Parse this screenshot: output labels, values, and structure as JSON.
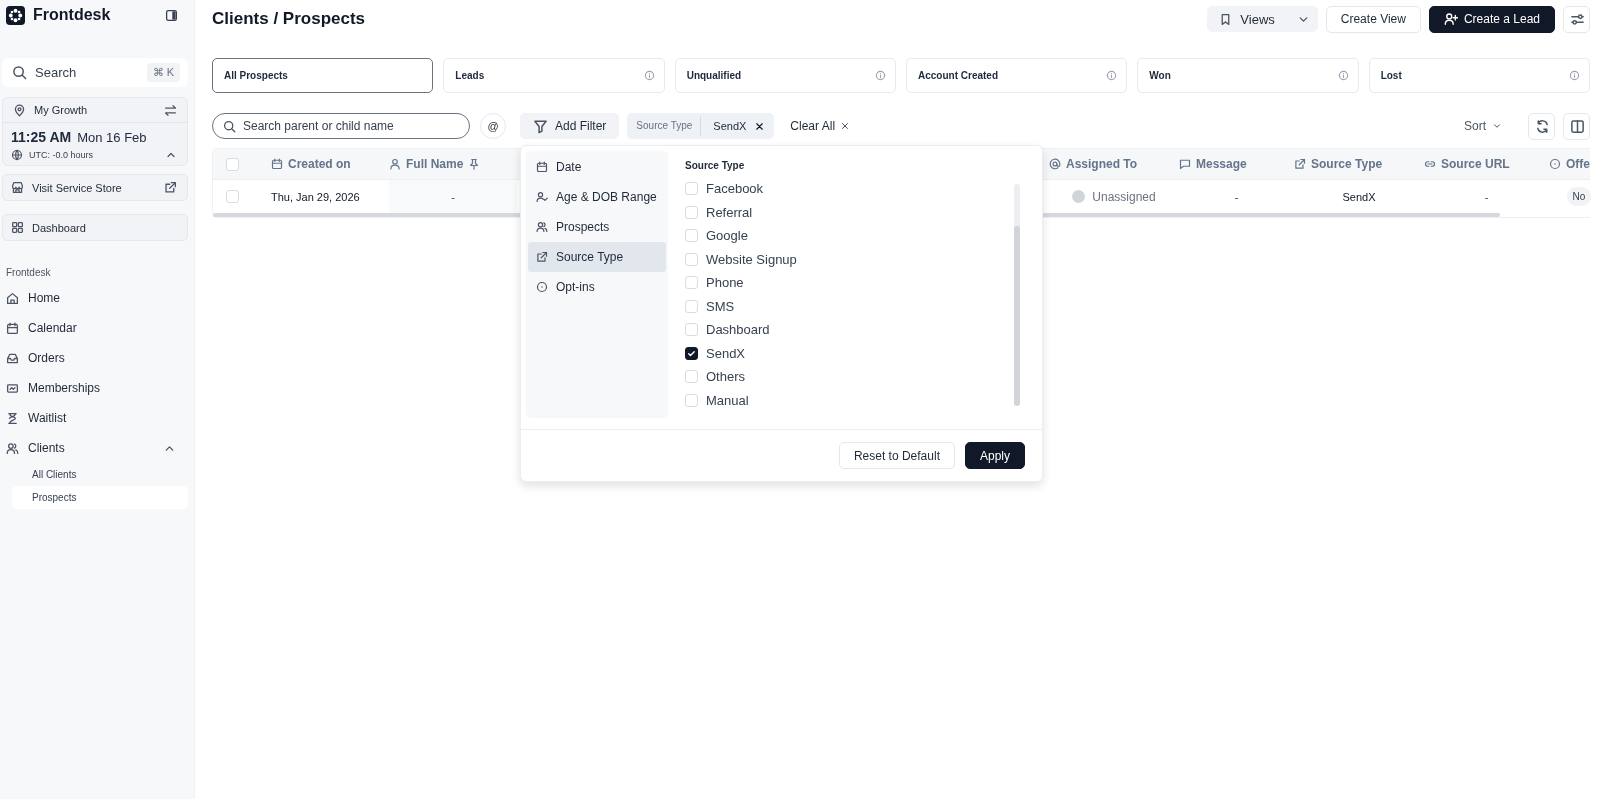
{
  "sidebar": {
    "brand": "Frontdesk",
    "search": {
      "placeholder": "Search",
      "shortcut": "⌘ K"
    },
    "location": {
      "label": "My Growth",
      "time": "11:25 AM",
      "date": "Mon 16 Feb",
      "timezone": "UTC: -0.0 hours",
      "expanded": true
    },
    "links": [
      {
        "label": "Visit Service Store",
        "external": true
      },
      {
        "label": "Dashboard",
        "external": false
      }
    ],
    "section_label": "Frontdesk",
    "nav": [
      {
        "label": "Home"
      },
      {
        "label": "Calendar"
      },
      {
        "label": "Orders"
      },
      {
        "label": "Memberships"
      },
      {
        "label": "Waitlist"
      },
      {
        "label": "Clients",
        "expanded": true,
        "children": [
          {
            "label": "All Clients",
            "selected": false
          },
          {
            "label": "Prospects",
            "selected": true
          }
        ]
      }
    ]
  },
  "header": {
    "title": "Clients / Prospects",
    "views": "Views",
    "create_view": "Create View",
    "create_lead": "Create a Lead"
  },
  "status_tabs": [
    {
      "label": "All Prospects",
      "selected": true,
      "info": false
    },
    {
      "label": "Leads",
      "selected": false,
      "info": true
    },
    {
      "label": "Unqualified",
      "selected": false,
      "info": true
    },
    {
      "label": "Account Created",
      "selected": false,
      "info": true
    },
    {
      "label": "Won",
      "selected": false,
      "info": true
    },
    {
      "label": "Lost",
      "selected": false,
      "info": true
    }
  ],
  "toolbar": {
    "search_placeholder": "Search parent or child name",
    "mention": "@",
    "add_filter": "Add Filter",
    "active_filter": {
      "field": "Source Type",
      "value": "SendX"
    },
    "clear_all": "Clear All",
    "sort": "Sort"
  },
  "table": {
    "select_all_checked": false,
    "columns": [
      {
        "label": "Created on"
      },
      {
        "label": "Full Name"
      },
      {
        "label": "Assigned To"
      },
      {
        "label": "Message"
      },
      {
        "label": "Source Type"
      },
      {
        "label": "Source URL"
      },
      {
        "label": "Offe"
      }
    ],
    "rows": [
      {
        "checked": false,
        "cells": [
          "Thu, Jan 29, 2026",
          "-",
          "Unassigned",
          "-",
          "SendX",
          "-",
          "No"
        ]
      }
    ]
  },
  "filter_popup": {
    "categories": [
      {
        "label": "Date",
        "selected": false
      },
      {
        "label": "Age & DOB Range",
        "selected": false
      },
      {
        "label": "Prospects",
        "selected": false
      },
      {
        "label": "Source Type",
        "selected": true
      },
      {
        "label": "Opt-ins",
        "selected": false
      }
    ],
    "heading": "Source Type",
    "options": [
      {
        "label": "Facebook",
        "checked": false
      },
      {
        "label": "Referral",
        "checked": false
      },
      {
        "label": "Google",
        "checked": false
      },
      {
        "label": "Website Signup",
        "checked": false
      },
      {
        "label": "Phone",
        "checked": false
      },
      {
        "label": "SMS",
        "checked": false
      },
      {
        "label": "Dashboard",
        "checked": false
      },
      {
        "label": "SendX",
        "checked": true
      },
      {
        "label": "Others",
        "checked": false
      },
      {
        "label": "Manual",
        "checked": false
      }
    ],
    "reset": "Reset to Default",
    "apply": "Apply"
  }
}
